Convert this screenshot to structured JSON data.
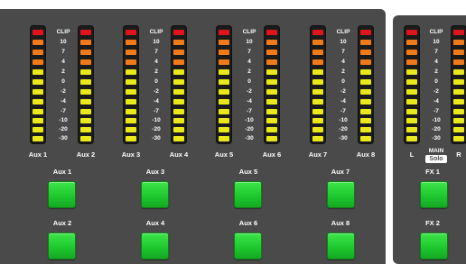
{
  "scale_labels": [
    "CLIP",
    "10",
    "7",
    "4",
    "2",
    "0",
    "-2",
    "-4",
    "-7",
    "-10",
    "-20",
    "-30"
  ],
  "segment_colors": [
    "#e0141c",
    "#f07a1a",
    "#f07a1a",
    "#f07a1a",
    "#e8e81a",
    "#e8e81a",
    "#e8e81a",
    "#e8e81a",
    "#e8e81a",
    "#e8e81a",
    "#e8e81a",
    "#e8e81a"
  ],
  "meter_groups": [
    {
      "left_label": "Aux 1",
      "right_label": "Aux 2"
    },
    {
      "left_label": "Aux 3",
      "right_label": "Aux 4"
    },
    {
      "left_label": "Aux 5",
      "right_label": "Aux 6"
    },
    {
      "left_label": "Aux 7",
      "right_label": "Aux 8"
    }
  ],
  "buttons_row1": [
    "Aux 1",
    "Aux 3",
    "Aux 5",
    "Aux 7"
  ],
  "buttons_row2": [
    "Aux 2",
    "Aux 4",
    "Aux 6",
    "Aux 8"
  ],
  "main_meter": {
    "left_label": "L",
    "right_label": "R",
    "main_label": "MAIN",
    "solo_label": "Solo"
  },
  "fx_buttons": [
    "FX 1",
    "FX 2"
  ],
  "colors": {
    "panel": "#4a4a4a",
    "button_green": "#1ec82e",
    "clip_red": "#e0141c",
    "orange": "#f07a1a",
    "yellow": "#e8e81a"
  }
}
